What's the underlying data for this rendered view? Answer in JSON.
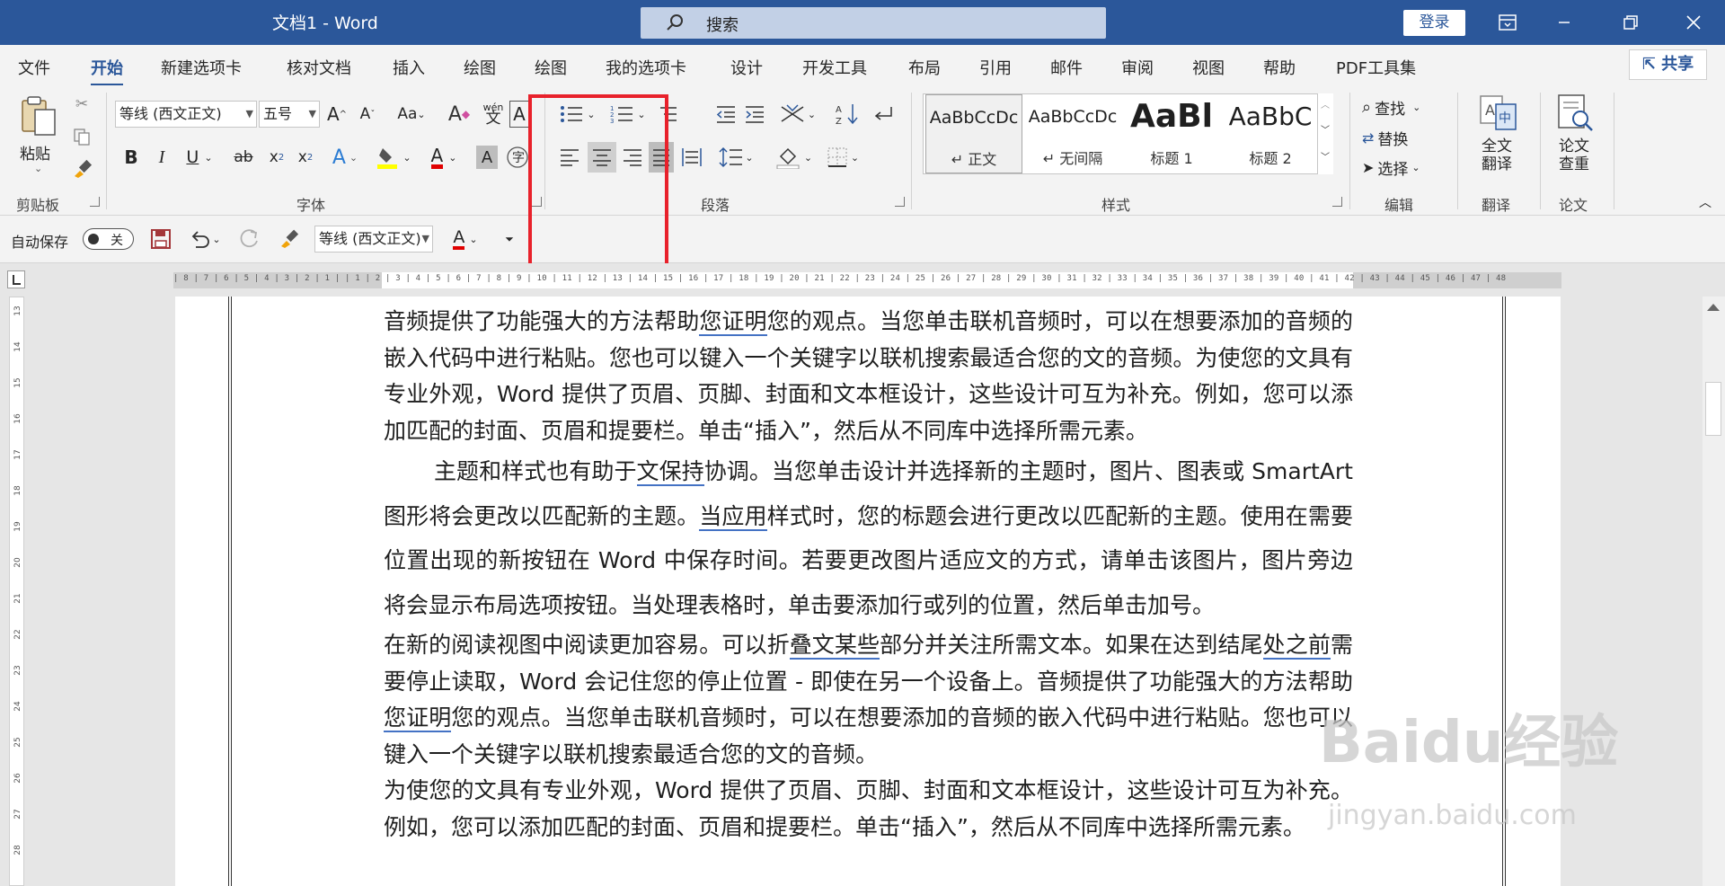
{
  "window": {
    "title": "文档1 - Word",
    "search_placeholder": "搜索",
    "login_label": "登录"
  },
  "tabs": [
    "文件",
    "开始",
    "新建选项卡",
    "核对文档",
    "插入",
    "绘图",
    "绘图",
    "我的选项卡",
    "设计",
    "开发工具",
    "布局",
    "引用",
    "邮件",
    "审阅",
    "视图",
    "帮助",
    "PDF工具集"
  ],
  "active_tab": "开始",
  "share_label": "共享",
  "ribbon": {
    "clipboard": {
      "paste_label": "粘贴",
      "group_label": "剪贴板"
    },
    "font": {
      "font_name": "等线 (西文正文)",
      "font_size": "五号",
      "group_label": "字体",
      "phonetic_label": "wén"
    },
    "paragraph": {
      "group_label": "段落"
    },
    "styles": {
      "group_label": "样式",
      "items": [
        {
          "preview": "AaBbCcDc",
          "name": "正文"
        },
        {
          "preview": "AaBbCcDc",
          "name": "无间隔"
        },
        {
          "preview": "AaBl",
          "name": "标题 1"
        },
        {
          "preview": "AaBbC",
          "name": "标题 2"
        }
      ]
    },
    "editing": {
      "find": "查找",
      "replace": "替换",
      "select": "选择",
      "group_label": "编辑"
    },
    "translate": {
      "label_line1": "全文",
      "label_line2": "翻译",
      "group_label": "翻译"
    },
    "paper": {
      "label_line1": "论文",
      "label_line2": "查重",
      "group_label": "论文"
    }
  },
  "qat": {
    "autosave_label": "自动保存",
    "autosave_state": "关",
    "font_name": "等线 (西文正文)"
  },
  "ruler": {
    "numbers": "| 8 | 7 | 6 | 5 | 4 | 3 | 2 | 1 |   | 1 | 2 | 3 | 4 | 5 | 6 | 7 | 8 | 9 | 10 | 11 | 12 | 13 | 14 | 15 | 16 | 17 | 18 | 19 | 20 | 21 | 22 | 23 | 24 | 25 | 26 | 27 | 28 | 29 | 30 | 31 | 32 | 33 | 34 | 35 | 36 | 37 | 38 | 39 | 40 | 41 | 42 | 43 | 44 | 45 | 46 | 47 | 48",
    "vertical": [
      "13",
      "14",
      "15",
      "16",
      "17",
      "18",
      "19",
      "20",
      "21",
      "22",
      "23",
      "24",
      "25",
      "26",
      "27",
      "28"
    ]
  },
  "document": {
    "p1": {
      "a": "音频提供了功能强大的方法帮助",
      "u": "您证明",
      "b": "您的观点。当您单击联机音频时，可以在想要添加的音频的嵌入代码中进行粘贴。您也可以键入一个关键字以联机搜索最适合您的文的音频。为使您的文具有专业外观，Word 提供了页眉、页脚、封面和文本框设计，这些设计可互为补充。例如，您可以添加匹配的封面、页眉和提要栏。单击“插入”，然后从不同库中选择所需元素。"
    },
    "p2": {
      "a": "主题和样式也有助于",
      "u1": "文保持",
      "b": "协调。当您单击设计并选择新的主题时，图片、图表或 SmartArt 图形将会更改以匹配新的主题。",
      "u2": "当应用",
      "c": "样式时，您的标题会进行更改以匹配新的主题。使用在需要位置出现的新按钮在 Word 中保存时间。若要更改图片适应文的方式，请单击该图片，图片旁边将会显示布局选项按钮。当处理表格时，单击要添加行或列的位置，然后单击加号。"
    },
    "p3": {
      "a": "在新的阅读视图中阅读更加容易。可以折",
      "u1": "叠文某些",
      "b": "部分并关注所需文本。如果在达到结尾",
      "u2": "处之前",
      "c": "需要停止读取，Word 会记住您的停止位置 - 即使在另一个设备上。音频提供了功能强大的方法帮助",
      "u3": "您证明",
      "d": "您的观点。当您单击联机音频时，可以在想要添加的音频的嵌入代码中进行粘贴。您也可以键入一个关键字以联机搜索最适合您的文的音频。"
    },
    "p4": "为使您的文具有专业外观，Word 提供了页眉、页脚、封面和文本框设计，这些设计可互为补充。例如，您可以添加匹配的封面、页眉和提要栏。单击“插入”，然后从不同库中选择所需元素。"
  },
  "watermark": {
    "brand": "Baidu经验",
    "sub": "jingyan.baidu.com"
  }
}
